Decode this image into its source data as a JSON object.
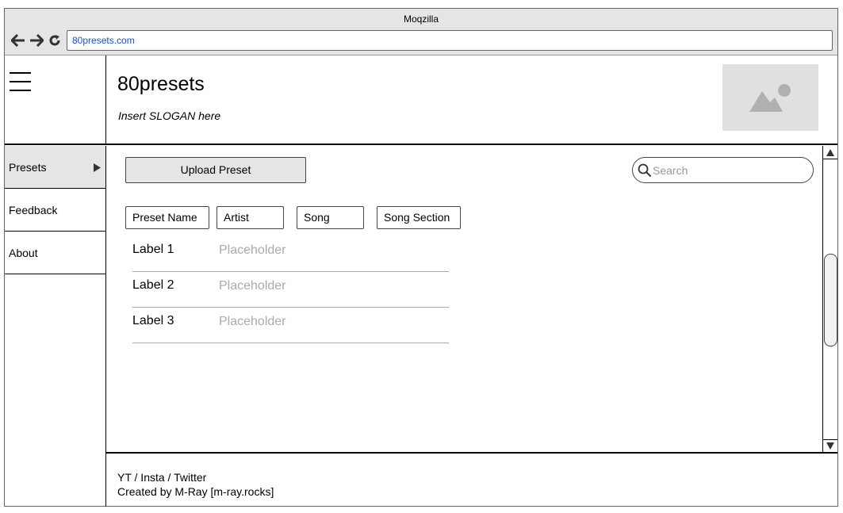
{
  "browser": {
    "title": "Moqzilla",
    "url": "80presets.com"
  },
  "header": {
    "site_title": "80presets",
    "slogan": "Insert SLOGAN here"
  },
  "sidebar": {
    "items": [
      {
        "label": "Presets",
        "active": true
      },
      {
        "label": "Feedback",
        "active": false
      },
      {
        "label": "About",
        "active": false
      }
    ]
  },
  "main": {
    "upload_button": "Upload Preset",
    "search": {
      "placeholder": "Search",
      "value": ""
    },
    "filters": [
      "Preset Name",
      "Artist",
      "Song",
      "Song Section"
    ],
    "form_rows": [
      {
        "label": "Label 1",
        "placeholder": "Placeholder"
      },
      {
        "label": "Label 2",
        "placeholder": "Placeholder"
      },
      {
        "label": "Label 3",
        "placeholder": "Placeholder"
      }
    ]
  },
  "footer": {
    "social": "YT / Insta / Twitter",
    "credit": "Created by M-Ray [m-ray.rocks]"
  },
  "icons": {
    "back": "arrow-left-icon",
    "forward": "arrow-right-icon",
    "reload": "reload-icon",
    "menu": "hamburger-icon",
    "logo": "image-placeholder-icon",
    "submenu": "triangle-right-icon",
    "search": "search-icon"
  },
  "colors": {
    "chrome": "#e5e5e5",
    "url_text": "#1a4fd6",
    "placeholder": "#aaaaaa"
  }
}
